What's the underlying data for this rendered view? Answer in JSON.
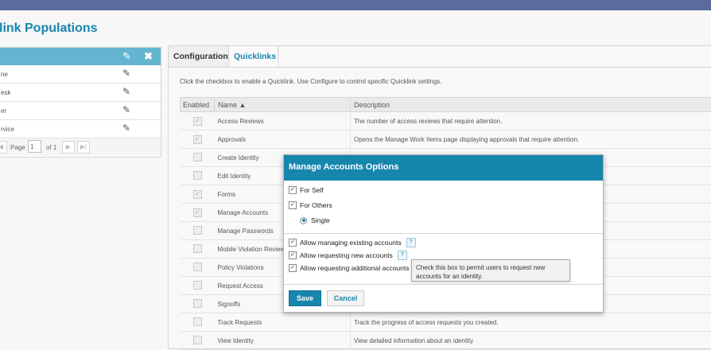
{
  "page": {
    "title": "link Populations"
  },
  "left_panel": {
    "rows": [
      {
        "label": "ne"
      },
      {
        "label": "esk"
      },
      {
        "label": "er"
      },
      {
        "label": "rvice"
      }
    ],
    "pager": {
      "page_label": "Page",
      "page_value": "1",
      "of_label": "of 1"
    }
  },
  "tabs": [
    {
      "label": "Configuration"
    },
    {
      "label": "Quicklinks"
    }
  ],
  "help_text": "Click the checkbox to enable a Quicklink. Use Configure to control specific Quicklink settings.",
  "table": {
    "headers": {
      "enabled": "Enabled",
      "name": "Name ▲",
      "description": "Description"
    },
    "rows": [
      {
        "checked": "✓",
        "name": "Access Reviews",
        "description": "The number of access reviews that require attention."
      },
      {
        "checked": "✓",
        "name": "Approvals",
        "description": "Opens the Manage Work Items page displaying approvals that require attention."
      },
      {
        "checked": "",
        "name": "Create Identity",
        "description": ""
      },
      {
        "checked": "",
        "name": "Edit Identity",
        "description": ""
      },
      {
        "checked": "✓",
        "name": "Forms",
        "description": ""
      },
      {
        "checked": "✓",
        "name": "Manage Accounts",
        "description": ""
      },
      {
        "checked": "",
        "name": "Manage Passwords",
        "description": ""
      },
      {
        "checked": "",
        "name": "Mobile Violation Review",
        "description": ""
      },
      {
        "checked": "",
        "name": "Policy Violations",
        "description": ""
      },
      {
        "checked": "",
        "name": "Request Access",
        "description": ""
      },
      {
        "checked": "",
        "name": "Signoffs",
        "description": ""
      },
      {
        "checked": "",
        "name": "Track Requests",
        "description": "Track the progress of access requests you created."
      },
      {
        "checked": "",
        "name": "View Identity",
        "description": "View detailed information about an identity"
      }
    ]
  },
  "modal": {
    "title": "Manage Accounts Options",
    "for_self": "For Self",
    "for_others": "For Others",
    "single": "Single",
    "allow_existing": "Allow managing existing accounts",
    "allow_new": "Allow requesting new accounts",
    "allow_additional": "Allow requesting additional accounts",
    "help_icon": "?",
    "check_mark": "✓",
    "save": "Save",
    "cancel": "Cancel"
  },
  "tooltip": "Check this box to permit users to request new accounts for an identity.",
  "colors": {
    "accent": "#1786ad",
    "header_bar": "#5b6b9c",
    "left_header": "#63b5d0"
  }
}
